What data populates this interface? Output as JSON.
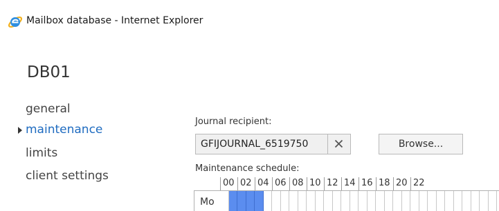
{
  "window": {
    "title": "Mailbox database - Internet Explorer",
    "icon": "internet-explorer-icon"
  },
  "page": {
    "heading": "DB01"
  },
  "nav": {
    "items": [
      {
        "label": "general",
        "active": false
      },
      {
        "label": "maintenance",
        "active": true
      },
      {
        "label": "limits",
        "active": false
      },
      {
        "label": "client settings",
        "active": false
      }
    ]
  },
  "journal": {
    "label": "Journal recipient:",
    "value": "GFIJOURNAL_6519750",
    "clear_icon": "close-icon",
    "browse_label": "Browse..."
  },
  "schedule": {
    "label": "Maintenance schedule:",
    "hours": [
      "00",
      "02",
      "04",
      "06",
      "08",
      "10",
      "12",
      "14",
      "16",
      "18",
      "20",
      "22"
    ],
    "days": [
      {
        "label": "Mo",
        "active_hours": [
          "01",
          "02",
          "03",
          "04"
        ]
      }
    ]
  },
  "colors": {
    "accent": "#1e6bc0",
    "schedule_active": "#5b8def"
  }
}
